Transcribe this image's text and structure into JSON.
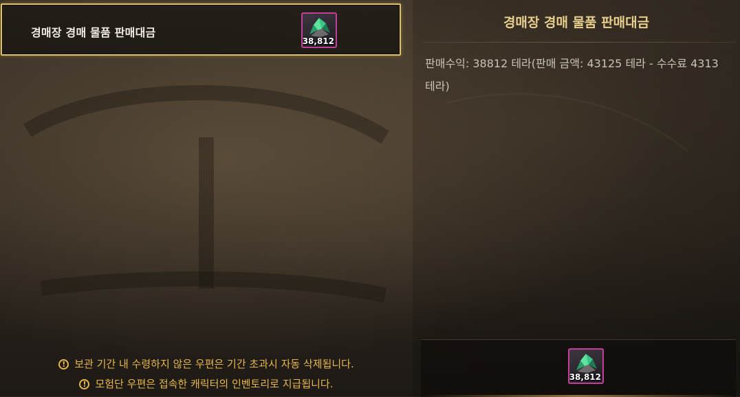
{
  "mail_list": {
    "items": [
      {
        "title": "경매장 경매 물품 판매대금",
        "attachment": {
          "icon": "green-crystal-icon",
          "quantity": "38,812"
        },
        "selected": true
      }
    ]
  },
  "detail": {
    "title": "경매장 경매 물품 판매대금",
    "body": "판매수익: 38812 테라(판매 금액: 43125 테라 - 수수료 4313 테라)",
    "attachment": {
      "icon": "green-crystal-icon",
      "quantity": "38,812"
    }
  },
  "notices": [
    "보관 기간 내 수령하지 않은 우편은 기간 초과시 자동 삭제됩니다.",
    "모험단 우편은 접속한 캐릭터의 인벤토리로 지급됩니다."
  ],
  "colors": {
    "selection_border": "#e1c261",
    "title_gold": "#e8cf8d",
    "notice_orange": "#e8b84a",
    "item_border": "#c43f9c"
  }
}
